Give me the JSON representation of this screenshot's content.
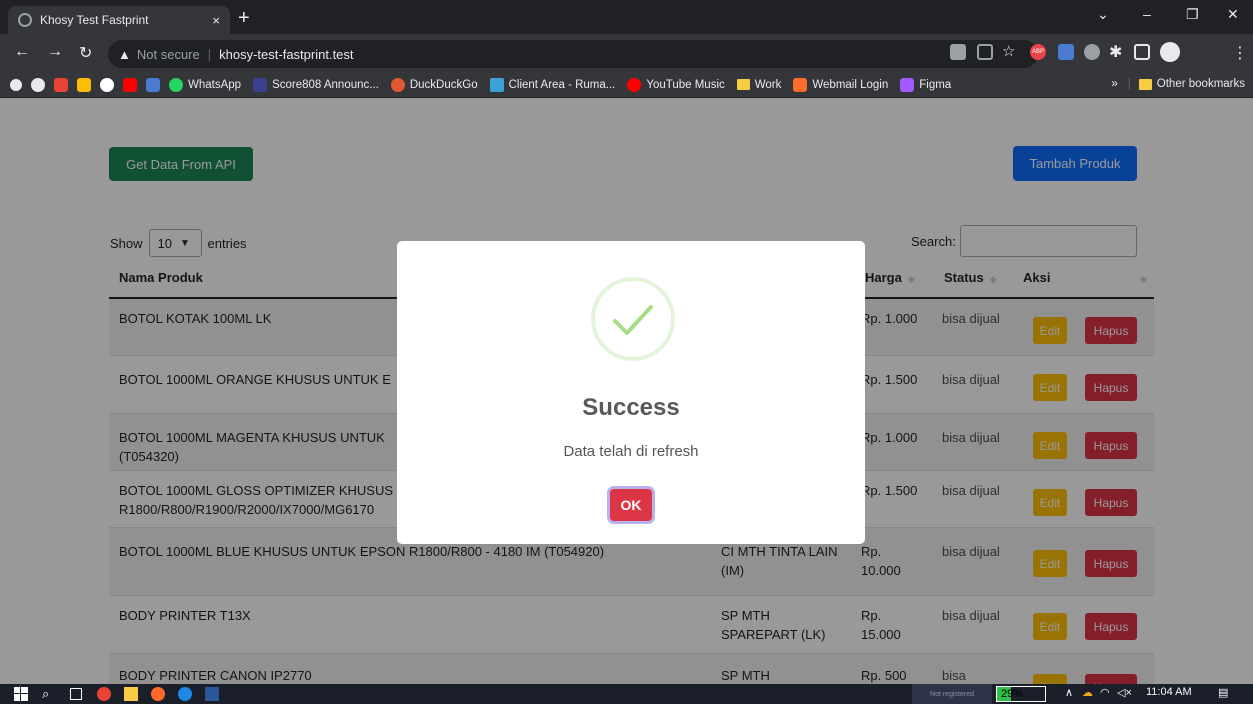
{
  "browser": {
    "tab_title": "Khosy Test Fastprint",
    "tab_close": "×",
    "new_tab": "+",
    "url_warning": "Not secure",
    "url": "khosy-test-fastprint.test",
    "bookmarks": [
      {
        "label": "WhatsApp",
        "color": "#25d366"
      },
      {
        "label": "Score808 Announc...",
        "color": "#3a3f8f"
      },
      {
        "label": "DuckDuckGo",
        "color": "#de5833"
      },
      {
        "label": "Client Area - Ruma...",
        "color": "#3ba2d8"
      },
      {
        "label": "YouTube Music",
        "color": "#ff0000"
      },
      {
        "label": "Work",
        "color": "#f9cc45"
      },
      {
        "label": "Webmail Login",
        "color": "#ff6c2c"
      },
      {
        "label": "Figma",
        "color": "#a259ff"
      }
    ],
    "overflow": "»",
    "other_bookmarks": "Other bookmarks"
  },
  "page": {
    "get_data_button": "Get Data From API",
    "add_product_button": "Tambah Produk",
    "show_label": "Show",
    "entries_value": "10",
    "entries_label": "entries",
    "search_label": "Search:",
    "columns": {
      "name": "Nama Produk",
      "harga": "Harga",
      "status": "Status",
      "aksi": "Aksi"
    },
    "edit_label": "Edit",
    "delete_label": "Hapus",
    "rows": [
      {
        "name": "BOTOL KOTAK 100ML LK",
        "kategori": "",
        "harga": "Rp. 1.000",
        "status": "bisa dijual"
      },
      {
        "name": "BOTOL 1000ML ORANGE KHUSUS UNTUK E",
        "kategori": "",
        "harga": "Rp. 1.500",
        "status": "bisa dijual"
      },
      {
        "name": "BOTOL 1000ML MAGENTA KHUSUS UNTUK (T054320)",
        "kategori": "",
        "harga": "Rp. 1.000",
        "status": "bisa dijual"
      },
      {
        "name": "BOTOL 1000ML GLOSS OPTIMIZER KHUSUS R1800/R800/R1900/R2000/IX7000/MG6170",
        "kategori": "",
        "harga": "Rp. 1.500",
        "status": "bisa dijual"
      },
      {
        "name": "BOTOL 1000ML BLUE KHUSUS UNTUK EPSON R1800/R800 - 4180 IM (T054920)",
        "kategori": "CI MTH TINTA LAIN (IM)",
        "harga": "Rp. 10.000",
        "status": "bisa dijual"
      },
      {
        "name": "BODY PRINTER T13X",
        "kategori": "SP MTH SPAREPART (LK)",
        "harga": "Rp. 15.000",
        "status": "bisa dijual"
      },
      {
        "name": "BODY PRINTER CANON IP2770",
        "kategori": "SP MTH",
        "harga": "Rp. 500",
        "status": "bisa"
      }
    ]
  },
  "modal": {
    "title": "Success",
    "text": "Data telah di refresh",
    "ok_label": "OK"
  },
  "taskbar": {
    "not_registered": "Not registered",
    "battery": "29%",
    "battery_level": 0.29,
    "time": "11:04 AM"
  }
}
